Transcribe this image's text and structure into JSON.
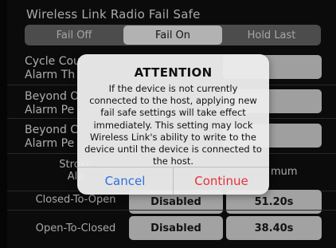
{
  "section": {
    "title": "Wireless Link Radio Fail Safe"
  },
  "fail_safe_modes": [
    {
      "label": "Fail Off"
    },
    {
      "label": "Fail On"
    },
    {
      "label": "Hold Last"
    }
  ],
  "selected_mode": "Fail On",
  "settings_rows": [
    {
      "line1": "Cycle Cou",
      "line2": "Alarm Th"
    },
    {
      "line1": "Beyond O",
      "line2": "Alarm Pe"
    },
    {
      "line1": "Beyond C",
      "line2": "Alarm Pe"
    }
  ],
  "table": {
    "header_col1_line1": "Stroke",
    "header_col1_line2": "Ala",
    "header_col3": "mum",
    "rows": [
      {
        "label": "Closed-To-Open",
        "value1": "Disabled",
        "value2": "51.20s"
      },
      {
        "label": "Open-To-Closed",
        "value1": "Disabled",
        "value2": "38.40s"
      }
    ]
  },
  "dialog": {
    "title": "ATTENTION",
    "message": "If the device is not currently connected to the host, applying new fail safe settings will take effect immediately. This setting may lock Wireless Link's ability to write to the device until the device is connected to the host.",
    "cancel_label": "Cancel",
    "continue_label": "Continue"
  },
  "colors": {
    "cancel": "#2f6fe0",
    "continue": "#e5313c"
  }
}
